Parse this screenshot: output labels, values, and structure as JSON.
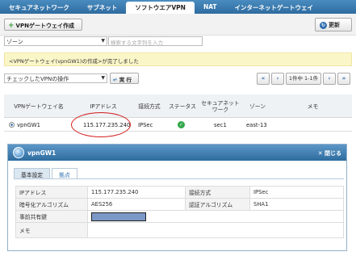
{
  "tabs": [
    "セキュアネットワーク",
    "サブネット",
    "ソフトウエアVPN",
    "NAT",
    "インターネットゲートウェイ"
  ],
  "active_tab_index": 2,
  "toolbar": {
    "create_label": "VPNゲートウェイ作成",
    "refresh_label": "更新"
  },
  "filter": {
    "zone_value": "ゾーン",
    "search_placeholder": "検索する文字列を入力"
  },
  "notice": "<VPNゲートウェイ(vpnGW1)の作成>が完了しました",
  "actions": {
    "select_value": "チェックしたVPNの操作",
    "exec_label": "実 行"
  },
  "pager": {
    "first": "«",
    "prev": "‹",
    "info": "1件中 1-1件",
    "next": "›",
    "last": "»"
  },
  "table": {
    "headers": [
      "VPNゲートウェイ名",
      "IPアドレス",
      "接続方式",
      "ステータス",
      "セキュアネット ワーク",
      "ゾーン",
      "メモ"
    ],
    "row": {
      "name": "vpnGW1",
      "ip": "115.177.235.240",
      "method": "IPSec",
      "status": "ok",
      "network": "sec1",
      "zone": "east-13",
      "memo": ""
    }
  },
  "detail": {
    "title": "vpnGW1",
    "close_label": "閉じる",
    "tabs": [
      "基本設定",
      "拠点"
    ],
    "fields": {
      "ip_label": "IPアドレス",
      "ip_value": "115.177.235.240",
      "method_label": "接続方式",
      "method_value": "IPSec",
      "enc_label": "暗号化アルゴリズム",
      "enc_value": "AES256",
      "auth_label": "認証アルゴリズム",
      "auth_value": "SHA1",
      "psk_label": "事前共有鍵",
      "memo_label": "メモ"
    }
  },
  "colors": {
    "header_blue": "#2f6c9f",
    "notice_bg": "#fbf6c8",
    "annotation_red": "#d31e1e",
    "redact_box": "#7b98c6"
  }
}
